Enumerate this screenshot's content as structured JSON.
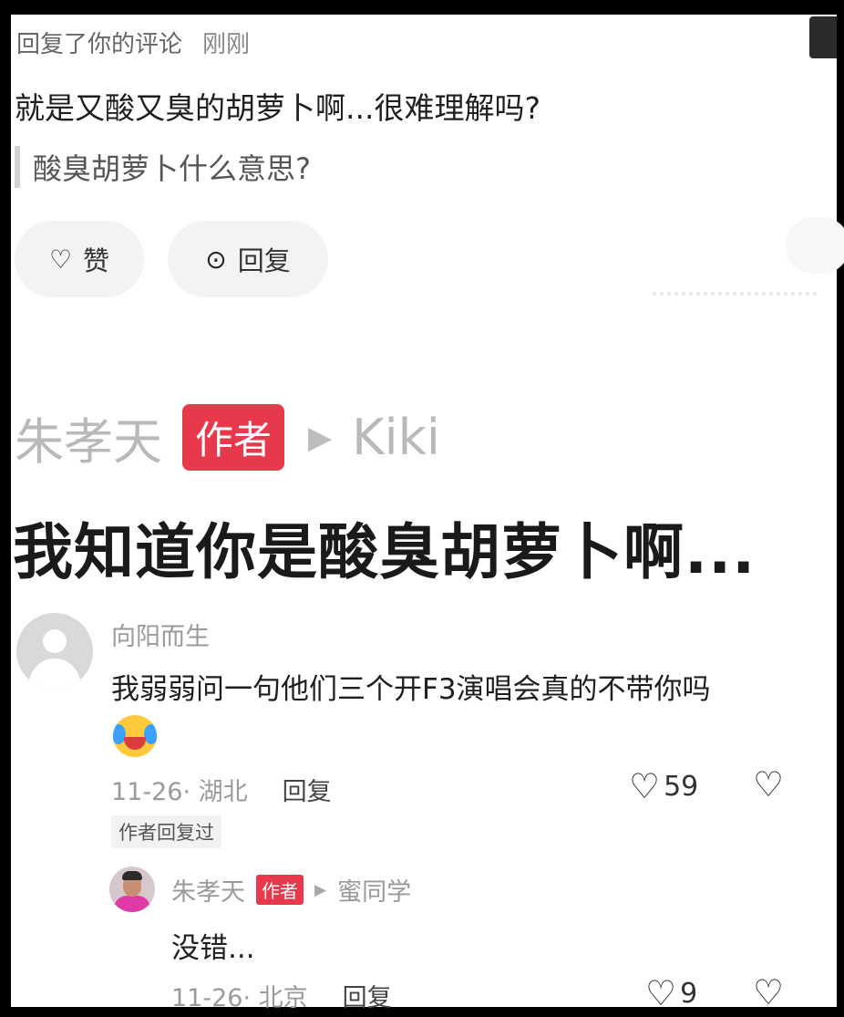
{
  "notice": {
    "action": "回复了你的评论",
    "time": "刚刚",
    "reply_text": "就是又酸又臭的胡萝卜啊...很难理解吗?",
    "quoted_text": "酸臭胡萝卜什么意思?",
    "like_label": "赞",
    "reply_label": "回复"
  },
  "author_reply": {
    "name": "朱孝天",
    "badge": "作者",
    "target": "Kiki",
    "text": "我知道你是酸臭胡萝卜啊..."
  },
  "comment": {
    "user": "向阳而生",
    "text": "我弱弱问一句他们三个开F3演唱会真的不带你吗",
    "date_location": "11-26· 湖北",
    "reply_label": "回复",
    "likes": "59",
    "author_replied_tag": "作者回复过"
  },
  "sub_reply": {
    "name": "朱孝天",
    "badge": "作者",
    "target": "蜜同学",
    "text": "没错...",
    "date_location": "11-26· 北京",
    "reply_label": "回复",
    "likes": "9"
  },
  "icons": {
    "heart": "heart-icon",
    "comment": "comment-bubble-icon",
    "broken_heart": "broken-heart-icon",
    "arrow": "play-arrow-icon"
  },
  "colors": {
    "badge": "#e8394c",
    "muted": "#9a9a9a"
  }
}
